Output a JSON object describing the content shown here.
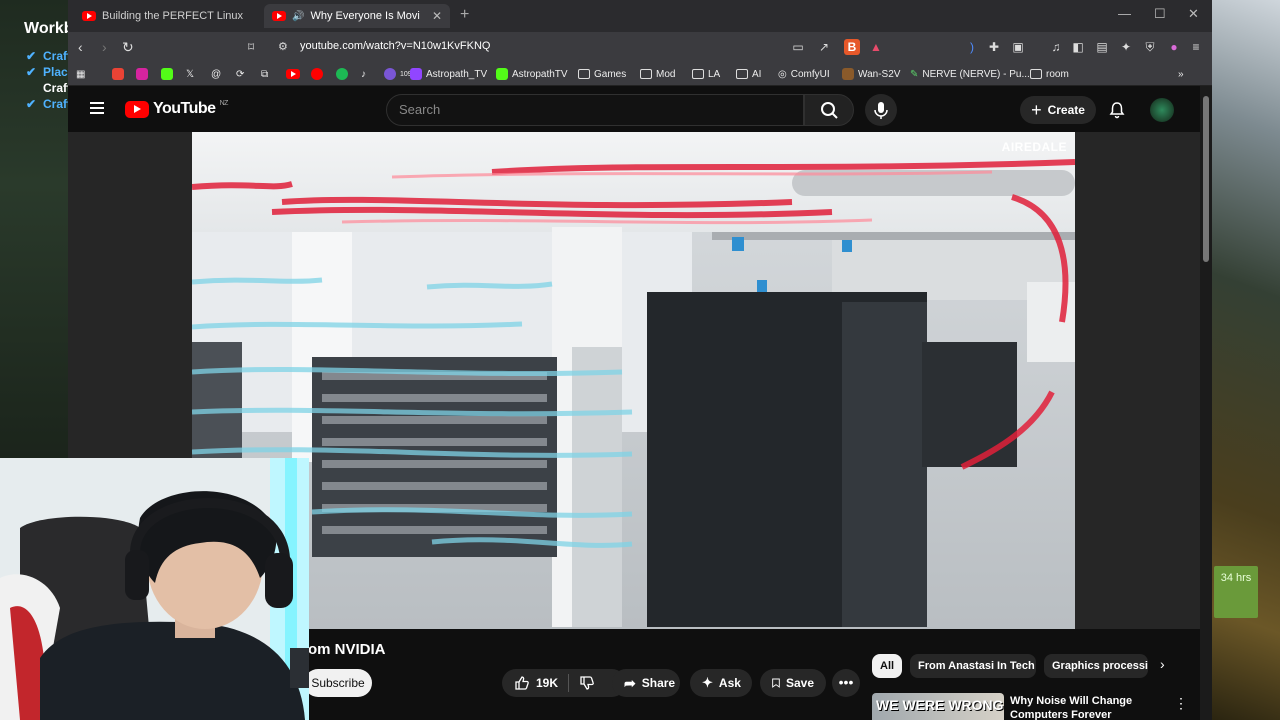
{
  "overlay": {
    "title": "Workb",
    "items": [
      {
        "label": "Craft",
        "checked": true
      },
      {
        "label": "Place",
        "checked": true
      },
      {
        "label": "Craft",
        "checked": false
      },
      {
        "label": "Craft",
        "checked": true
      }
    ]
  },
  "desktop": {
    "hours_badge": "34 hrs"
  },
  "browser": {
    "tabs": [
      {
        "title": "Building the PERFECT Linux PC with I",
        "active": false
      },
      {
        "title": "Why Everyone Is Moving Aw",
        "active": true
      }
    ],
    "url": "youtube.com/watch?v=N10w1KvFKNQ",
    "brave_badge": "8",
    "bookmarks": [
      {
        "label": "Astropath_TV",
        "icon_color": "#9146ff"
      },
      {
        "label": "AstropathTV",
        "icon_color": "#53fc18"
      },
      {
        "label": "Games",
        "folder": true
      },
      {
        "label": "Mod",
        "folder": true
      },
      {
        "label": "LA",
        "folder": true
      },
      {
        "label": "AI",
        "folder": true
      },
      {
        "label": "ComfyUI"
      },
      {
        "label": "Wan-S2V"
      },
      {
        "label": "NERVE (NERVE) - Pu..."
      },
      {
        "label": "room",
        "folder": true
      }
    ],
    "small_bookmark_badge": "109"
  },
  "youtube": {
    "logo_text": "YouTube",
    "region": "NZ",
    "search_placeholder": "Search",
    "create_label": "Create",
    "video_watermark": "AIREDALE",
    "video_title_fragment": "om NVIDIA",
    "subscribe_label": "Subscribe",
    "like_count": "19K",
    "share_label": "Share",
    "ask_label": "Ask",
    "save_label": "Save",
    "chips": [
      "All",
      "From Anastasi In Tech",
      "Graphics processi"
    ],
    "recommendation": {
      "thumb_text": "WE WERE WRONG",
      "title": "Why Noise Will Change Computers Forever"
    }
  },
  "colors": {
    "accent_red": "#ff0000",
    "youtube_bg": "#0f0f0f",
    "browser_chrome": "#3b3b3f"
  }
}
